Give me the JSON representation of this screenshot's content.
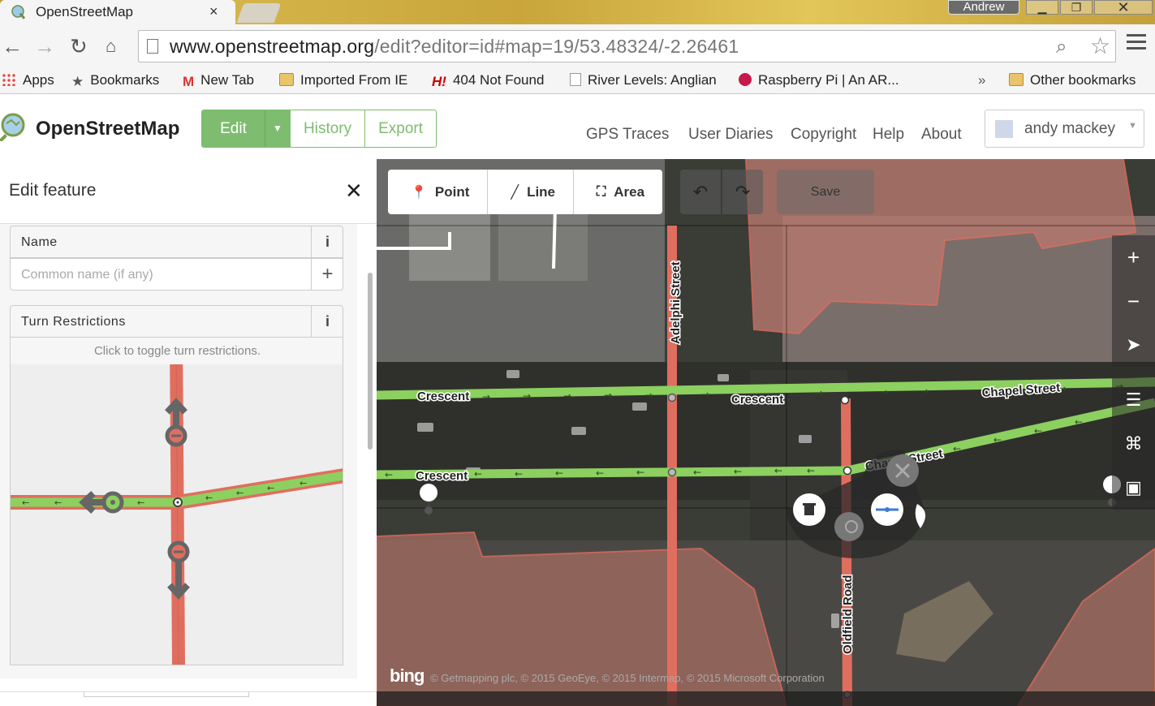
{
  "browser": {
    "tab_title": "OpenStreetMap",
    "tab_close": "×",
    "window_user": "Andrew",
    "url_host": "www.openstreetmap.org",
    "url_path": "/edit?editor=id#map=19/53.48324/-2.26461"
  },
  "bookmarks": [
    {
      "label": "Apps",
      "icon": "apps-grid-icon"
    },
    {
      "label": "Bookmarks",
      "icon": "star-icon"
    },
    {
      "label": "New Tab",
      "icon": "gmail-icon"
    },
    {
      "label": "Imported From IE",
      "icon": "folder-icon"
    },
    {
      "label": "404 Not Found",
      "icon": "h-logo-icon"
    },
    {
      "label": "River Levels: Anglian",
      "icon": "page-icon"
    },
    {
      "label": "Raspberry Pi | An AR...",
      "icon": "raspberry-icon"
    }
  ],
  "bookmarks_more": "»",
  "bookmarks_other": "Other bookmarks",
  "osm": {
    "site_title": "OpenStreetMap",
    "edit": "Edit",
    "history": "History",
    "export": "Export",
    "nav": [
      "GPS Traces",
      "User Diaries",
      "Copyright",
      "Help",
      "About"
    ],
    "user": "andy mackey"
  },
  "sidebar": {
    "title": "Edit feature",
    "name_label": "Name",
    "name_placeholder": "Common name (if any)",
    "turn_label": "Turn Restrictions",
    "turn_hint": "Click to toggle turn restrictions.",
    "info_glyph": "i"
  },
  "editor": {
    "point": "Point",
    "line": "Line",
    "area": "Area",
    "save": "Save",
    "zoom_in": "+",
    "zoom_out": "−"
  },
  "map_labels": {
    "crescent": "Crescent",
    "chapel_street": "Chapel Street",
    "adelphi_street": "Adelphi Street",
    "oldfield_road": "Oldfield Road"
  },
  "attribution": {
    "bing": "bing",
    "text": "© Getmapping plc, © 2015 GeoEye, © 2015 Intermap, © 2015 Microsoft Corporation"
  },
  "colors": {
    "osm_green": "#7ebc6f",
    "road_red": "#e06e5f",
    "oneway_green": "#8cd05f"
  }
}
